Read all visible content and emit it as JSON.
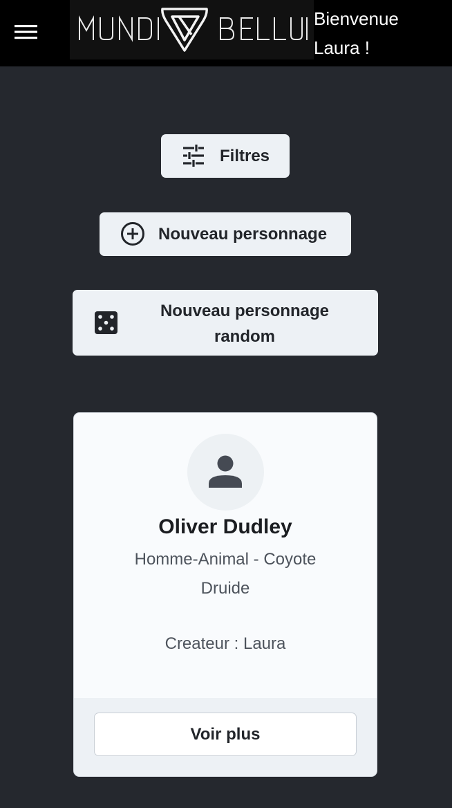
{
  "header": {
    "logo_text": "MUNDI BELLUM",
    "welcome": "Bienvenue Laura !"
  },
  "icons": {
    "menu": "hamburger-menu-icon",
    "filter": "sliders-icon",
    "new": "plus-circle-icon",
    "random": "dice-icon",
    "avatar": "person-icon"
  },
  "actions": {
    "filter_label": "Filtres",
    "new_label": "Nouveau personnage",
    "random_label": "Nouveau personnage random"
  },
  "character": {
    "name": "Oliver Dudley",
    "race": "Homme-Animal - Coyote",
    "class": "Druide",
    "creator": "Createur : Laura",
    "more_label": "Voir plus"
  },
  "colors": {
    "background": "#25282e",
    "topbar": "#000000",
    "button": "#edf1f5",
    "card": "#f9fbfd",
    "text_dark": "#22252a",
    "text_muted": "#4d535c"
  }
}
